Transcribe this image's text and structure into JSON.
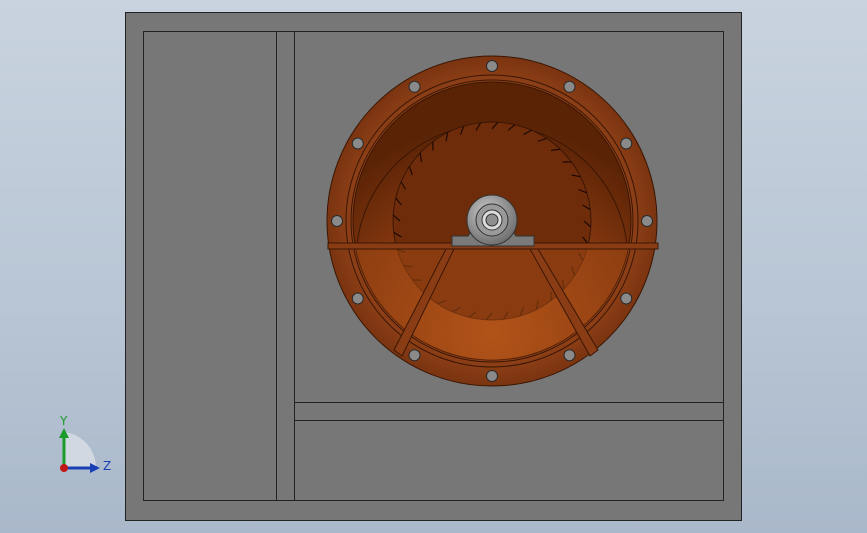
{
  "scene": {
    "colors": {
      "background_top": "#c9d3df",
      "background_bottom": "#a9b8ca",
      "housing": "#777777",
      "housing_edge": "#222222",
      "flange": "#8a3d14",
      "flange_inner": "#7a3410",
      "bowl_dark": "#5e2508",
      "bowl_light": "#b5571a",
      "bolt_hole": "#8a8a8a",
      "bearing": "#8c8c8c",
      "bearing_dark": "#555555"
    },
    "fan": {
      "bolt_count": 12,
      "blade_count": 36
    }
  },
  "triad": {
    "y_label": "Y",
    "z_label": "Z",
    "y_color": "#1c9b2a",
    "z_color": "#1a3fb5",
    "x_color": "#c01818"
  }
}
